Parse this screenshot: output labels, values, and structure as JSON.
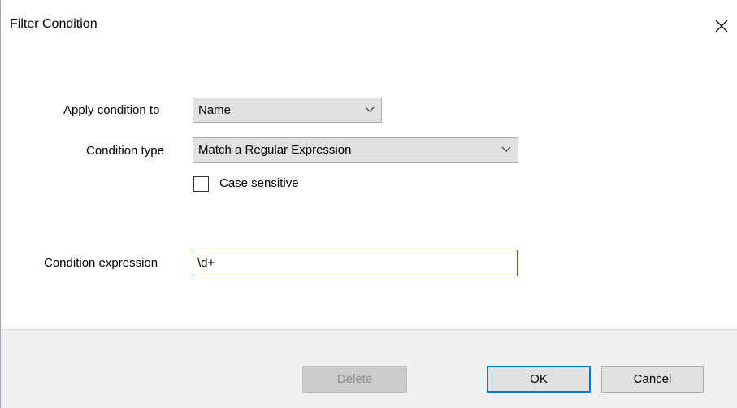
{
  "window": {
    "title": "Filter Condition",
    "close_icon": "close-icon"
  },
  "form": {
    "apply_condition_label": "Apply condition to",
    "apply_condition_value": "Name",
    "condition_type_label": "Condition type",
    "condition_type_value": "Match a Regular Expression",
    "case_sensitive_label": "Case sensitive",
    "case_sensitive_checked": false,
    "condition_expression_label": "Condition expression",
    "condition_expression_value": "\\d+"
  },
  "buttons": {
    "delete_first": "D",
    "delete_rest": "elete",
    "delete_enabled": false,
    "ok_first": "O",
    "ok_rest": "K",
    "cancel_first": "C",
    "cancel_rest": "ancel"
  },
  "colors": {
    "focus_accent": "#0078d7",
    "footer_bg": "#f0f0f0",
    "button_bg": "#e1e1e1",
    "disabled_button_bg": "#cccccc"
  }
}
